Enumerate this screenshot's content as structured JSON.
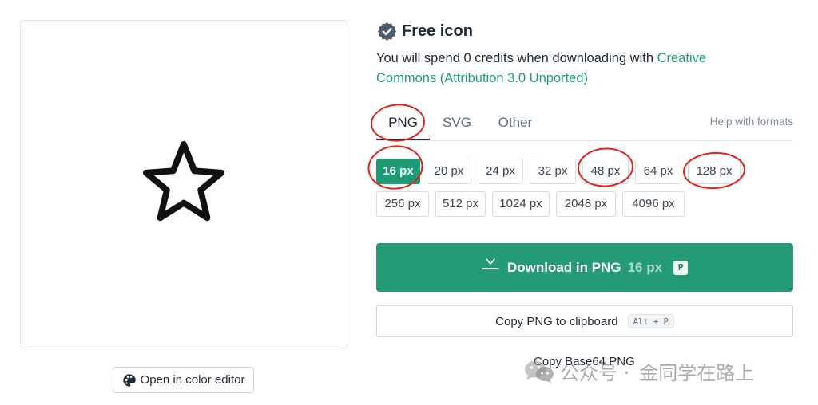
{
  "preview": {
    "icon": "star-outline-icon"
  },
  "color_editor": {
    "label": "Open in color editor",
    "icon": "palette-icon"
  },
  "header": {
    "title": "Free icon",
    "badge_icon": "verified-badge-icon"
  },
  "credits": {
    "text": "You will spend 0 credits when downloading with ",
    "license_link": "Creative Commons (Attribution 3.0 Unported)"
  },
  "tabs": [
    {
      "label": "PNG",
      "active": true
    },
    {
      "label": "SVG",
      "active": false
    },
    {
      "label": "Other",
      "active": false
    }
  ],
  "help_formats": "Help with formats",
  "sizes": [
    {
      "label": "16 px",
      "active": true
    },
    {
      "label": "20 px",
      "active": false
    },
    {
      "label": "24 px",
      "active": false
    },
    {
      "label": "32 px",
      "active": false
    },
    {
      "label": "48 px",
      "active": false
    },
    {
      "label": "64 px",
      "active": false
    },
    {
      "label": "128 px",
      "active": false
    },
    {
      "label": "256 px",
      "active": false
    },
    {
      "label": "512 px",
      "active": false
    },
    {
      "label": "1024 px",
      "active": false
    },
    {
      "label": "2048 px",
      "active": false
    },
    {
      "label": "4096 px",
      "active": false
    }
  ],
  "download": {
    "label": "Download in PNG",
    "size": "16 px",
    "shortcut": "P",
    "icon": "download-icon"
  },
  "copy_png": {
    "label": "Copy PNG to clipboard",
    "shortcut": "Alt + P"
  },
  "copy_base64": {
    "label": "Copy Base64 PNG"
  },
  "watermark": {
    "text": "公众号 ·",
    "text2": "金同学在路上",
    "icon": "wechat-logo-icon"
  },
  "colors": {
    "accent": "#1d9b74",
    "download_bg": "#249b76",
    "annotation_red": "#e0231c"
  }
}
